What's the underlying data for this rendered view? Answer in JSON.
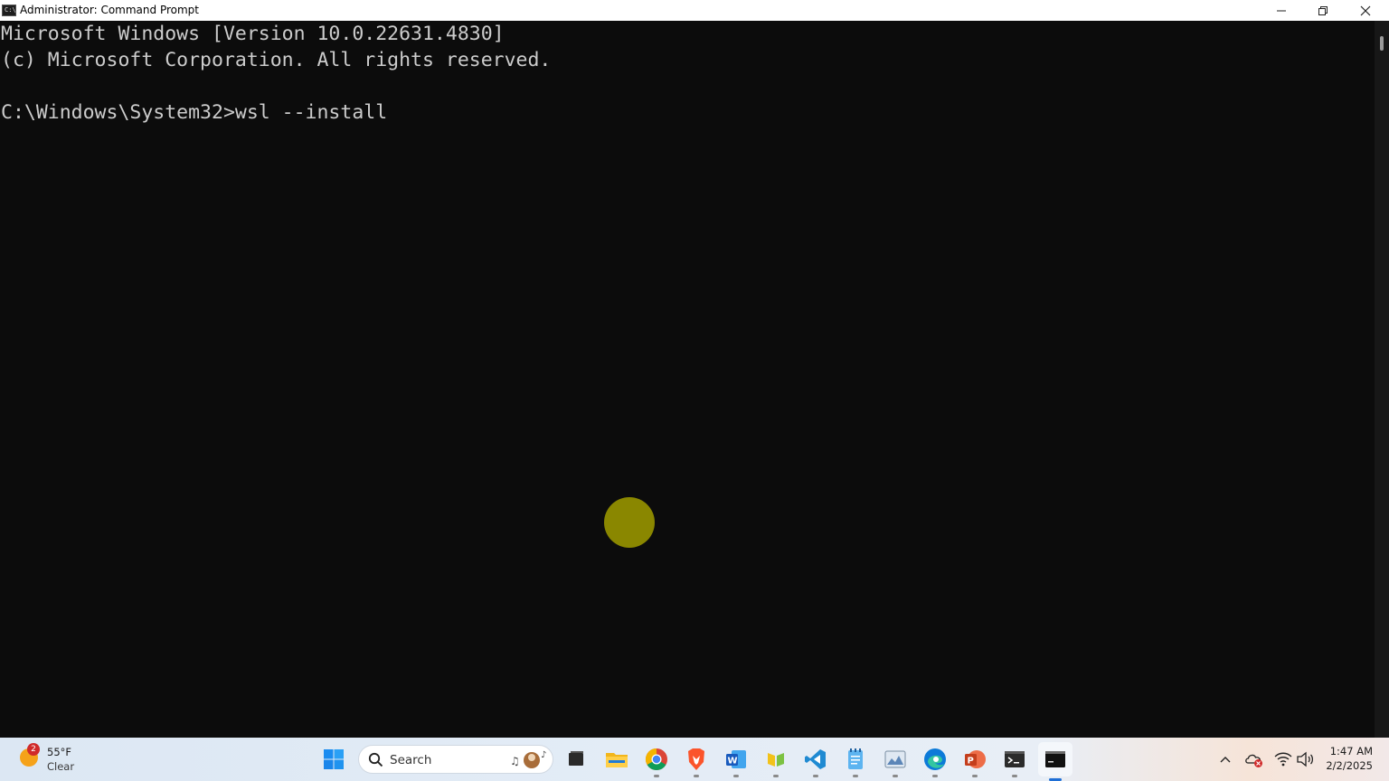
{
  "window": {
    "title": "Administrator: Command Prompt",
    "icon": "cmd-icon",
    "icon_text": "C:\\",
    "controls": [
      "minimize-icon",
      "restore-icon",
      "close-icon"
    ]
  },
  "console": {
    "lines": [
      "Microsoft Windows [Version 10.0.22631.4830]",
      "(c) Microsoft Corporation. All rights reserved.",
      "",
      "C:\\Windows\\System32>wsl --install"
    ],
    "text_color": "#cccccc",
    "background": "#0c0c0c"
  },
  "cursor_highlight_color": "#8a8700",
  "taskbar": {
    "weather": {
      "badge": "2",
      "temp": "55°F",
      "condition": "Clear",
      "icon": "sun-icon"
    },
    "search": {
      "label": "Search",
      "icon": "search-icon"
    },
    "apps": [
      {
        "name": "start",
        "icon": "windows-start-icon"
      },
      {
        "name": "task-view",
        "icon": "task-view-icon"
      },
      {
        "name": "file-explorer",
        "icon": "folder-icon"
      },
      {
        "name": "chrome",
        "icon": "chrome-icon"
      },
      {
        "name": "brave",
        "icon": "brave-icon"
      },
      {
        "name": "word",
        "icon": "word-icon"
      },
      {
        "name": "app-green",
        "icon": "green-app-icon"
      },
      {
        "name": "vscode",
        "icon": "vscode-icon"
      },
      {
        "name": "notepad",
        "icon": "notepad-icon"
      },
      {
        "name": "photos",
        "icon": "photos-icon"
      },
      {
        "name": "edge",
        "icon": "edge-icon"
      },
      {
        "name": "powerpoint",
        "icon": "powerpoint-icon"
      },
      {
        "name": "terminal",
        "icon": "terminal-icon"
      },
      {
        "name": "command-prompt",
        "icon": "cmd-icon"
      }
    ],
    "tray": {
      "icons": [
        "chevron-up-icon",
        "onedrive-error-icon",
        "wifi-icon",
        "volume-icon"
      ],
      "time": "1:47 AM",
      "date": "2/2/2025"
    }
  }
}
